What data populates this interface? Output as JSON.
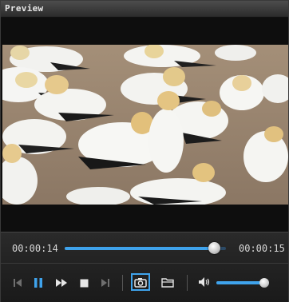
{
  "window": {
    "title": "Preview"
  },
  "player": {
    "current_time": "00:00:14",
    "total_time": "00:00:15",
    "progress_percent": 93,
    "volume_percent": 100
  },
  "colors": {
    "accent": "#3fa3ec",
    "background": "#121212"
  },
  "icons": {
    "previous": "skip-previous-icon",
    "pause": "pause-icon",
    "fast_forward": "fast-forward-icon",
    "stop": "stop-icon",
    "next": "skip-next-icon",
    "snapshot": "camera-icon",
    "folder": "folder-icon",
    "volume": "volume-icon"
  }
}
